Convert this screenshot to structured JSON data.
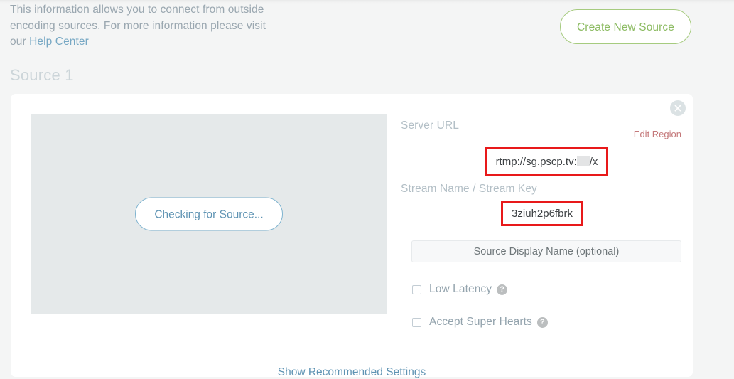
{
  "intro": {
    "line1": "This information allows you to connect from outside",
    "line2": "encoding sources. For more information please visit",
    "line3_prefix": "our ",
    "link_label": "Help Center"
  },
  "header": {
    "create_button_label": "Create New Source"
  },
  "source_section": {
    "heading": "Source 1"
  },
  "preview": {
    "status_button_label": "Checking for Source..."
  },
  "card": {
    "close_icon_name": "close-icon"
  },
  "fields": {
    "server_url_label": "Server URL",
    "server_url_prefix": "rtmp://sg.pscp.tv:",
    "server_url_suffix": "/x",
    "edit_region_label": "Edit Region",
    "stream_key_label": "Stream Name / Stream Key",
    "stream_key_value": "3ziuh2p6fbrk",
    "display_name_placeholder": "Source Display Name (optional)",
    "display_name_value": ""
  },
  "options": [
    {
      "label": "Low Latency",
      "checked": false,
      "help": "?"
    },
    {
      "label": "Accept Super Hearts",
      "checked": false,
      "help": "?"
    }
  ],
  "footer": {
    "recommended_settings_label": "Show Recommended Settings"
  },
  "colors": {
    "page_background": "#f4f5f5",
    "accent_green": "#8cbb62",
    "accent_blue": "#5e93b3",
    "annotation_red": "#e8191a",
    "muted_text": "#b3bfc6",
    "edit_region_red": "#c4787a"
  }
}
